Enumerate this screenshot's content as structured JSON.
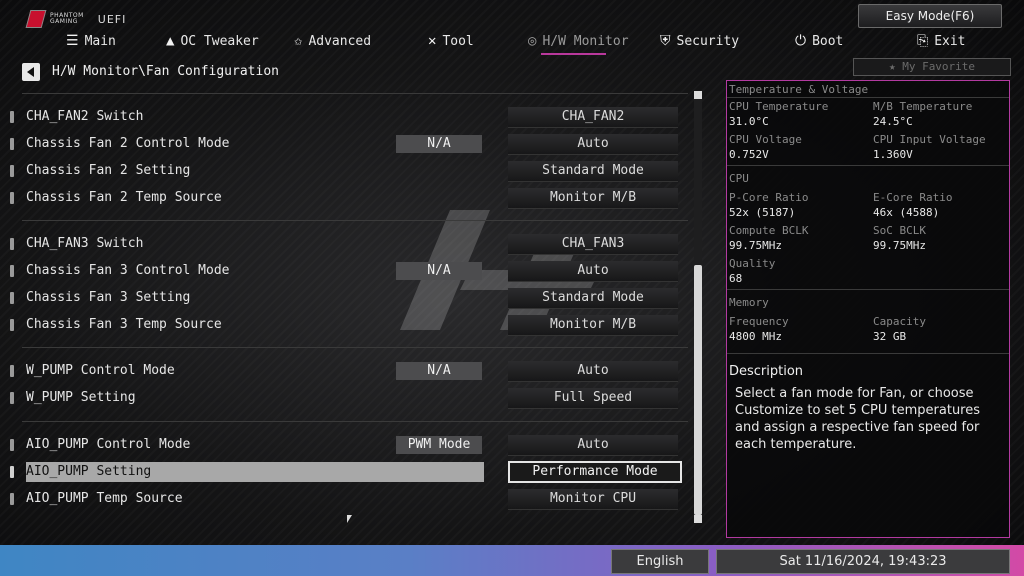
{
  "header": {
    "brand_line1": "PHANTOM",
    "brand_line2": "GAMING",
    "uefi": "UEFI",
    "easy_mode": "Easy Mode(F6)"
  },
  "nav": [
    {
      "label": "Main",
      "icon": "list-icon"
    },
    {
      "label": "OC Tweaker",
      "icon": "rocket-icon"
    },
    {
      "label": "Advanced",
      "icon": "star-swoosh-icon"
    },
    {
      "label": "Tool",
      "icon": "tools-icon"
    },
    {
      "label": "H/W Monitor",
      "icon": "monitor-icon",
      "active": true
    },
    {
      "label": "Security",
      "icon": "shield-icon"
    },
    {
      "label": "Boot",
      "icon": "power-icon"
    },
    {
      "label": "Exit",
      "icon": "exit-icon"
    }
  ],
  "breadcrumb": "H/W Monitor\\Fan Configuration",
  "favorite": "★ My Favorite",
  "rows": [
    {
      "label": "CHA_FAN2 Switch",
      "value": "CHA_FAN2",
      "badge": ""
    },
    {
      "label": "Chassis Fan 2 Control Mode",
      "value": "Auto",
      "badge": "N/A"
    },
    {
      "label": "Chassis Fan 2 Setting",
      "value": "Standard Mode",
      "badge": ""
    },
    {
      "label": "Chassis Fan 2 Temp Source",
      "value": "Monitor M/B",
      "badge": ""
    },
    {
      "label": "CHA_FAN3 Switch",
      "value": "CHA_FAN3",
      "badge": ""
    },
    {
      "label": "Chassis Fan 3 Control Mode",
      "value": "Auto",
      "badge": "N/A"
    },
    {
      "label": "Chassis Fan 3 Setting",
      "value": "Standard Mode",
      "badge": ""
    },
    {
      "label": "Chassis Fan 3 Temp Source",
      "value": "Monitor M/B",
      "badge": ""
    },
    {
      "label": "W_PUMP Control Mode",
      "value": "Auto",
      "badge": "N/A"
    },
    {
      "label": "W_PUMP Setting",
      "value": "Full Speed",
      "badge": ""
    },
    {
      "label": "AIO_PUMP Control Mode",
      "value": "Auto",
      "badge": "PWM Mode"
    },
    {
      "label": "AIO_PUMP Setting",
      "value": "Performance Mode",
      "badge": "",
      "selected": true
    },
    {
      "label": "AIO_PUMP Temp Source",
      "value": "Monitor CPU",
      "badge": ""
    }
  ],
  "panel": {
    "section_title": "Temperature & Voltage",
    "cpu_temp_label": "CPU Temperature",
    "cpu_temp": "31.0°C",
    "mb_temp_label": "M/B Temperature",
    "mb_temp": "24.5°C",
    "cpu_volt_label": "CPU Voltage",
    "cpu_volt": "0.752V",
    "cpu_in_volt_label": "CPU Input Voltage",
    "cpu_in_volt": "1.360V",
    "cpu_title": "CPU",
    "pcore_label": "P-Core Ratio",
    "pcore": "52x (5187)",
    "ecore_label": "E-Core Ratio",
    "ecore": "46x (4588)",
    "bclk_label": "Compute BCLK",
    "bclk": "99.75MHz",
    "soc_label": "SoC BCLK",
    "soc": "99.75MHz",
    "quality_label": "Quality",
    "quality": "68",
    "mem_title": "Memory",
    "freq_label": "Frequency",
    "freq": "4800 MHz",
    "cap_label": "Capacity",
    "cap": "32 GB",
    "desc_title": "Description",
    "desc": "Select a fan mode for Fan, or choose Customize to set 5 CPU temperatures and assign a respective fan speed for each temperature."
  },
  "footer": {
    "language": "English",
    "datetime": "Sat 11/16/2024, 19:43:23"
  },
  "colors": {
    "accent": "#b23aa0",
    "bar_start": "#3f86c4",
    "bar_end": "#d34aa6"
  }
}
